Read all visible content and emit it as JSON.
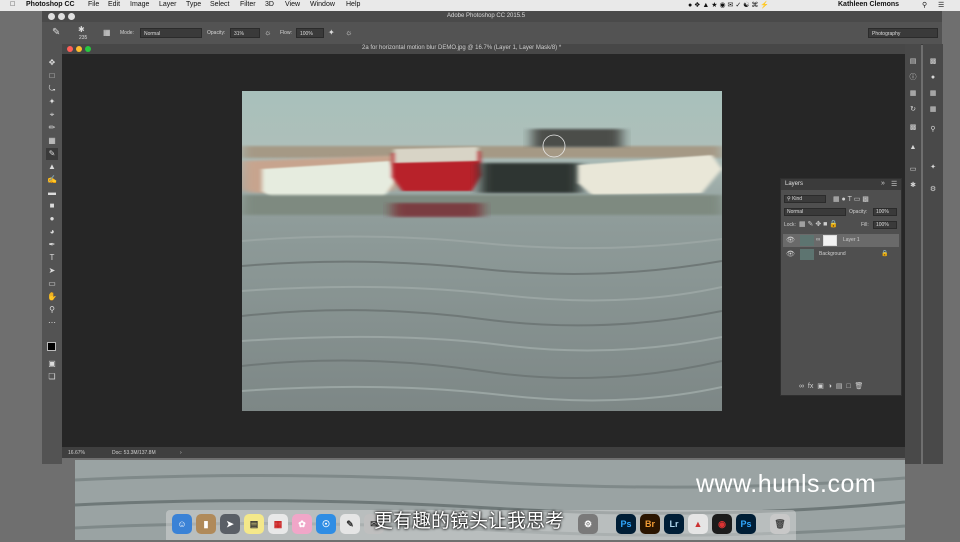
{
  "menubar": {
    "app": "Photoshop CC",
    "items": [
      "File",
      "Edit",
      "Image",
      "Layer",
      "Type",
      "Select",
      "Filter",
      "3D",
      "View",
      "Window",
      "Help"
    ],
    "user": "Kathleen Clemons"
  },
  "window": {
    "title": "Adobe Photoshop CC 2015.5"
  },
  "options": {
    "brush_size": "235",
    "mode_label": "Mode:",
    "mode_value": "Normal",
    "opacity_label": "Opacity:",
    "opacity_value": "31%",
    "flow_label": "Flow:",
    "flow_value": "100%",
    "workspace": "Photography"
  },
  "document": {
    "tab_title": "2a for horizontal motion blur DEMO.jpg @ 16.7% (Layer 1, Layer Mask/8) *",
    "zoom": "16.67%",
    "doc_size": "Doc: 53.3M/137.8M"
  },
  "layers_panel": {
    "title": "Layers",
    "kind": "Kind",
    "blend_mode": "Normal",
    "opacity_label": "Opacity:",
    "opacity_value": "100%",
    "lock_label": "Lock:",
    "fill_label": "Fill:",
    "fill_value": "100%",
    "layers": [
      {
        "name": "Layer 1"
      },
      {
        "name": "Background"
      }
    ]
  },
  "dock": {
    "apps": [
      "Ps",
      "Br",
      "Lr",
      "Ps"
    ]
  },
  "watermark": "www.hunls.com",
  "subtitle": "更有趣的镜头让我思考",
  "colors": {
    "ps_blue": "#31a8ff",
    "bridge_orange": "#f39c34",
    "lr_blue": "#add5ec",
    "boat_red": "#b8202a"
  }
}
